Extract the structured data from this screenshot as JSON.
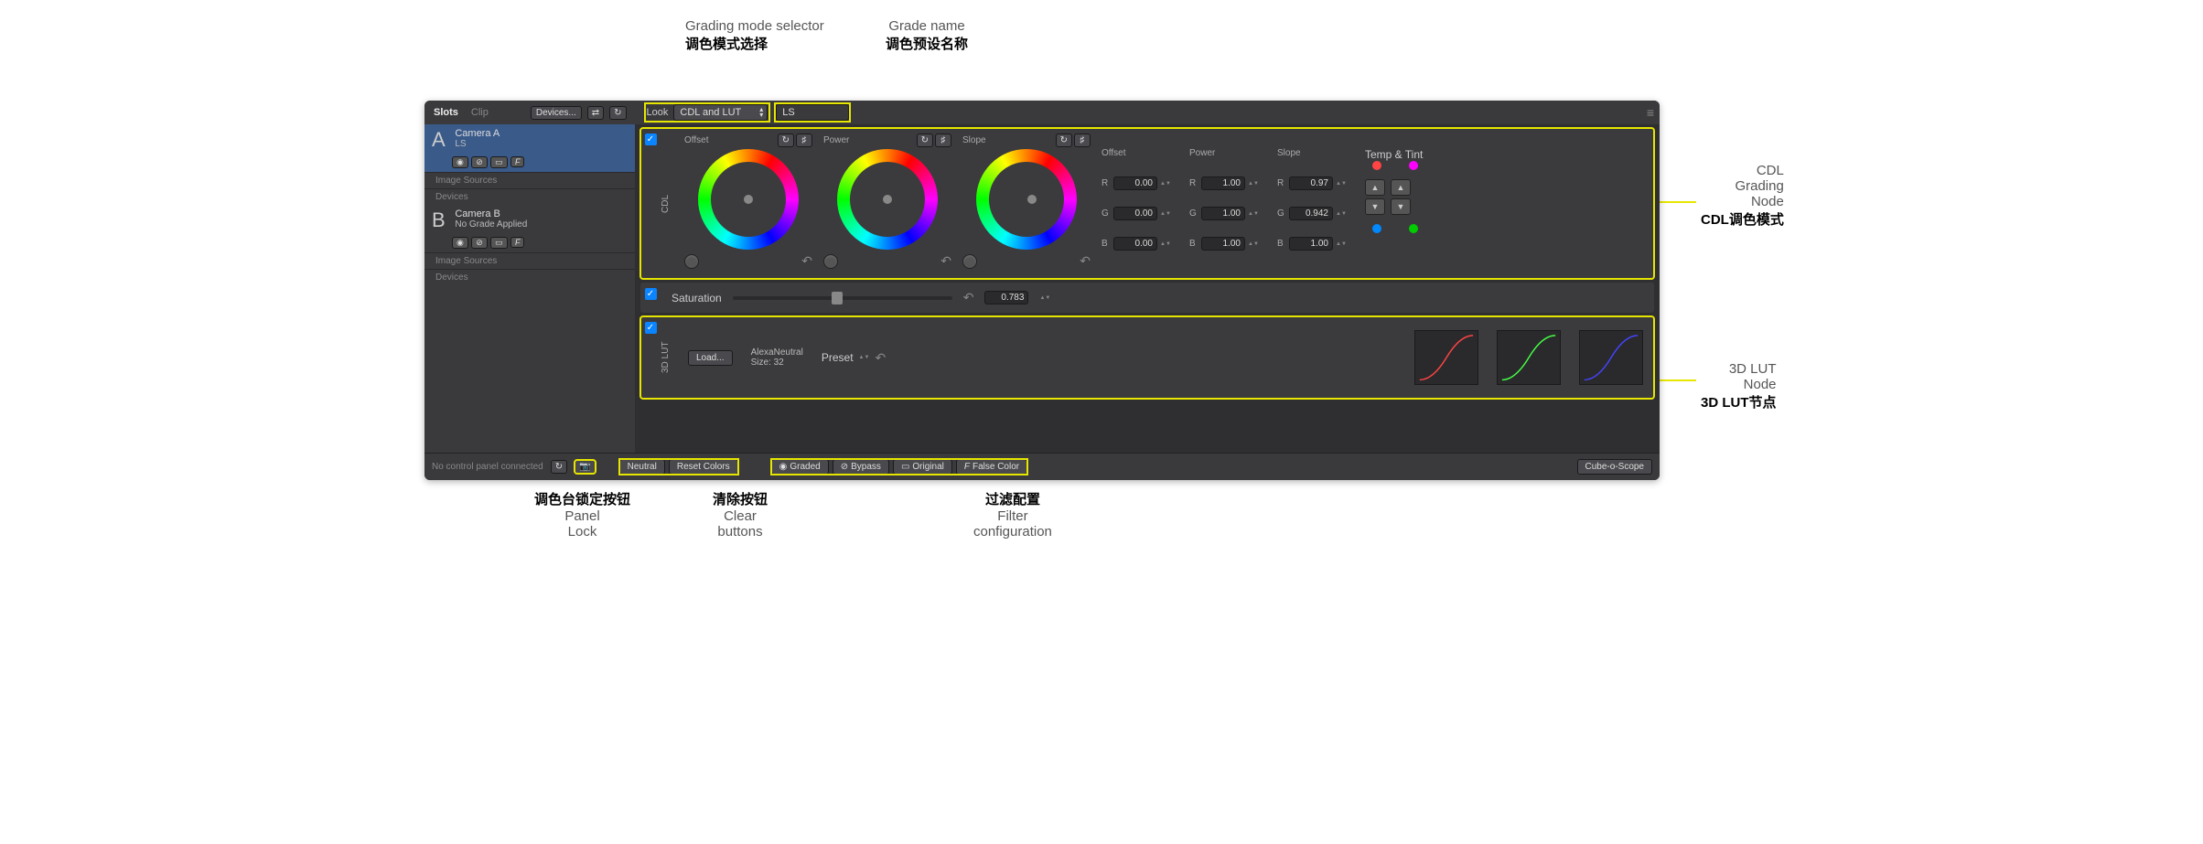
{
  "annotations": {
    "grading_mode_en": "Grading mode selector",
    "grading_mode_cn": "调色模式选择",
    "grade_name_en": "Grade name",
    "grade_name_cn": "调色预设名称",
    "cdl_node_en1": "CDL",
    "cdl_node_en2": "Grading",
    "cdl_node_en3": "Node",
    "cdl_node_cn": "CDL调色模式",
    "lut_node_en1": "3D LUT",
    "lut_node_en2": "Node",
    "lut_node_cn": "3D LUT节点",
    "panel_lock_cn": "调色台锁定按钮",
    "panel_lock_en1": "Panel",
    "panel_lock_en2": "Lock",
    "clear_cn": "清除按钮",
    "clear_en1": "Clear",
    "clear_en2": "buttons",
    "filter_cn": "过滤配置",
    "filter_en1": "Filter",
    "filter_en2": "configuration"
  },
  "topbar": {
    "tab_slots": "Slots",
    "tab_clip": "Clip",
    "devices": "Devices..."
  },
  "look": {
    "label": "Look",
    "mode": "CDL and LUT",
    "name": "LS"
  },
  "slots": {
    "a": {
      "letter": "A",
      "name": "Camera A",
      "grade": "LS"
    },
    "b": {
      "letter": "B",
      "name": "Camera B",
      "grade": "No Grade Applied"
    },
    "meta1": "Image Sources",
    "meta2": "Devices"
  },
  "cdl": {
    "label": "CDL",
    "offset": "Offset",
    "power": "Power",
    "slope": "Slope",
    "temptint": "Temp & Tint",
    "offset_r": "0.00",
    "offset_g": "0.00",
    "offset_b": "0.00",
    "power_r": "1.00",
    "power_g": "1.00",
    "power_b": "1.00",
    "slope_r": "0.97",
    "slope_g": "0.942",
    "slope_b": "1.00"
  },
  "sat": {
    "label": "Saturation",
    "value": "0.783"
  },
  "lut": {
    "label": "3D LUT",
    "load": "Load...",
    "name": "AlexaNeutral",
    "size": "Size: 32",
    "preset": "Preset"
  },
  "footer": {
    "status": "No control panel connected",
    "neutral": "Neutral",
    "reset": "Reset Colors",
    "graded": "Graded",
    "bypass": "Bypass",
    "original": "Original",
    "false_color": "False Color",
    "scope": "Cube-o-Scope"
  },
  "labels": {
    "r": "R",
    "g": "G",
    "b": "B",
    "f": "F"
  }
}
